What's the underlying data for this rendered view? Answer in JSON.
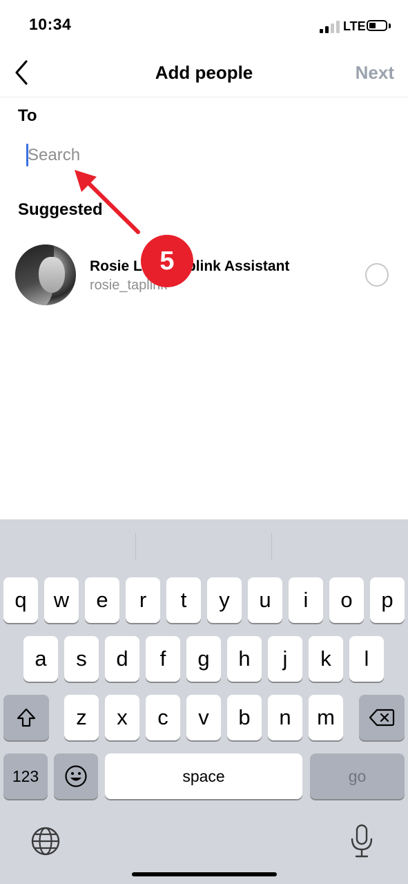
{
  "status_bar": {
    "time": "10:34",
    "network": "LTE"
  },
  "nav": {
    "title": "Add people",
    "next_label": "Next"
  },
  "to_label": "To",
  "search": {
    "placeholder": "Search",
    "value": ""
  },
  "suggested_label": "Suggested",
  "suggested_users": [
    {
      "name": "Rosie Lee - Taplink Assistant",
      "handle": "rosie_taplink",
      "selected": false
    }
  ],
  "annotation": {
    "step": "5",
    "color": "#e8202b"
  },
  "keyboard": {
    "row1": [
      "q",
      "w",
      "e",
      "r",
      "t",
      "y",
      "u",
      "i",
      "o",
      "p"
    ],
    "row2": [
      "a",
      "s",
      "d",
      "f",
      "g",
      "h",
      "j",
      "k",
      "l"
    ],
    "row3": [
      "z",
      "x",
      "c",
      "v",
      "b",
      "n",
      "m"
    ],
    "numbers_label": "123",
    "space_label": "space",
    "go_label": "go"
  },
  "colors": {
    "next_disabled": "#9aa3ad",
    "caret": "#3b6fe0",
    "keyboard_bg": "#d2d5db",
    "function_key": "#abb0bb"
  }
}
